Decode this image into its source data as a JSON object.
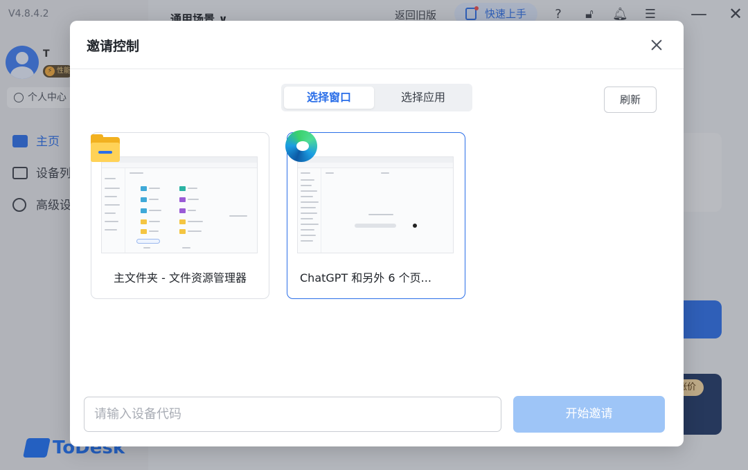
{
  "app": {
    "version": "V4.8.4.2",
    "user_name": "T",
    "user_badge": "性能",
    "profile_label": "个人中心",
    "logo_text": "ToDesk"
  },
  "sidebar": {
    "items": [
      {
        "label": "主页",
        "icon": "monitor-icon",
        "active": true
      },
      {
        "label": "设备列",
        "icon": "devices-icon",
        "active": false
      },
      {
        "label": "高级设",
        "icon": "gear-icon",
        "active": false
      }
    ]
  },
  "topbar": {
    "scene": "通用场景 ∨",
    "old_version": "返回旧版",
    "quick_start": "快速上手",
    "icons": [
      "help-icon",
      "lock-icon",
      "bell-icon",
      "menu-icon"
    ],
    "minimize": "—",
    "close": "✕"
  },
  "background": {
    "promo_tag": "涨价"
  },
  "dialog": {
    "title": "邀请控制",
    "tabs": [
      {
        "label": "选择窗口",
        "active": true
      },
      {
        "label": "选择应用",
        "active": false
      }
    ],
    "refresh_label": "刷新",
    "windows": [
      {
        "label": "主文件夹 - 文件资源管理器",
        "icon": "folder-icon",
        "selected": false
      },
      {
        "label": "ChatGPT 和另外 6 个页...",
        "icon": "edge-icon",
        "selected": true
      }
    ],
    "device_code_input": {
      "value": "",
      "placeholder": "请输入设备代码"
    },
    "start_label": "开始邀请"
  },
  "colors": {
    "accent": "#2a6ee8",
    "start_button_disabled": "#9ec5f7"
  }
}
